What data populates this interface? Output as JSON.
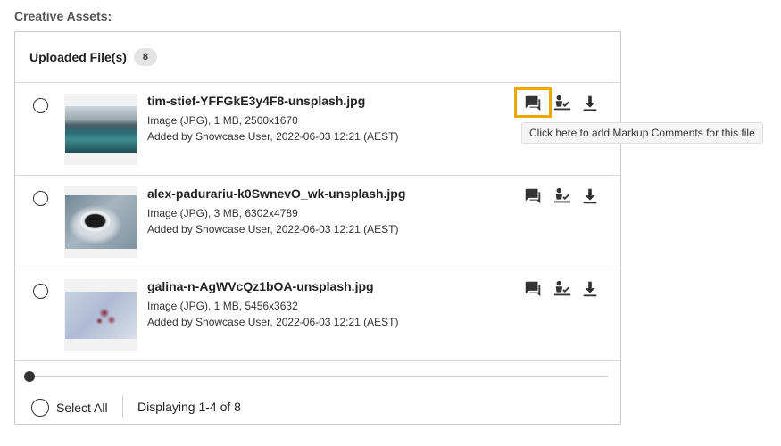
{
  "section": {
    "label": "Creative Assets:"
  },
  "panel": {
    "title": "Uploaded File(s)",
    "count": "8"
  },
  "files": [
    {
      "name": "tim-stief-YFFGkE3y4F8-unsplash.jpg",
      "meta": "Image (JPG), 1 MB, 2500x1670",
      "added": "Added by Showcase User, 2022-06-03 12:21 (AEST)",
      "thumbnail": "mountain-lake-photo"
    },
    {
      "name": "alex-padurariu-k0SwnevO_wk-unsplash.jpg",
      "meta": "Image (JPG), 3 MB, 6302x4789",
      "added": "Added by Showcase User, 2022-06-03 12:21 (AEST)",
      "thumbnail": "coffee-cup-photo"
    },
    {
      "name": "galina-n-AgWVcQz1bOA-unsplash.jpg",
      "meta": "Image (JPG), 1 MB, 5456x3632",
      "added": "Added by Showcase User, 2022-06-03 12:21 (AEST)",
      "thumbnail": "frosted-flowers-photo"
    }
  ],
  "row_actions": {
    "icons": [
      "markup-comment-icon",
      "approve-icon",
      "download-icon"
    ],
    "highlight_color": "#f0a800"
  },
  "tooltip": {
    "text": "Click here to add Markup Comments for this file"
  },
  "footer": {
    "select_all_label": "Select All",
    "display_count": "Displaying 1-4 of 8"
  },
  "colors": {
    "border": "#c8c8c8",
    "badge_bg": "#e4e4e4",
    "icon": "#333333"
  }
}
